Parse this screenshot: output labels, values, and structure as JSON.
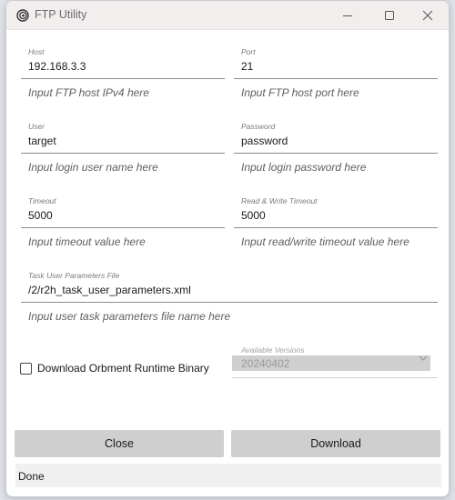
{
  "window": {
    "title": "FTP Utility",
    "minimize_icon": "minimize-icon",
    "maximize_icon": "maximize-icon",
    "close_icon": "close-icon",
    "app_icon": "spiral-icon"
  },
  "fields": {
    "host": {
      "caption": "Host",
      "value": "192.168.3.3",
      "hint": "Input FTP host IPv4 here"
    },
    "port": {
      "caption": "Port",
      "value": "21",
      "hint": "Input FTP host port here"
    },
    "user": {
      "caption": "User",
      "value": "target",
      "hint": "Input login user name here"
    },
    "password": {
      "caption": "Password",
      "value": "password",
      "hint": "Input login password here"
    },
    "timeout": {
      "caption": "Timeout",
      "value": "5000",
      "hint": "Input timeout value here"
    },
    "rw_timeout": {
      "caption": "Read & Write Timeout",
      "value": "5000",
      "hint": "Input read/write timeout value here"
    },
    "task_file": {
      "caption": "Task User Parameters File",
      "value": "/2/r2h_task_user_parameters.xml",
      "hint": "Input user task parameters file name here"
    }
  },
  "download_runtime": {
    "label": "Download Orbment Runtime Binary",
    "checked": false
  },
  "versions": {
    "caption": "Available Versions",
    "selected": "20240402",
    "enabled": false
  },
  "buttons": {
    "close": "Close",
    "download": "Download"
  },
  "status": {
    "text": "Done"
  },
  "colors": {
    "titlebar": "#f3eeee",
    "button": "#cfcfcf",
    "status_bar": "#f0f0f0"
  }
}
